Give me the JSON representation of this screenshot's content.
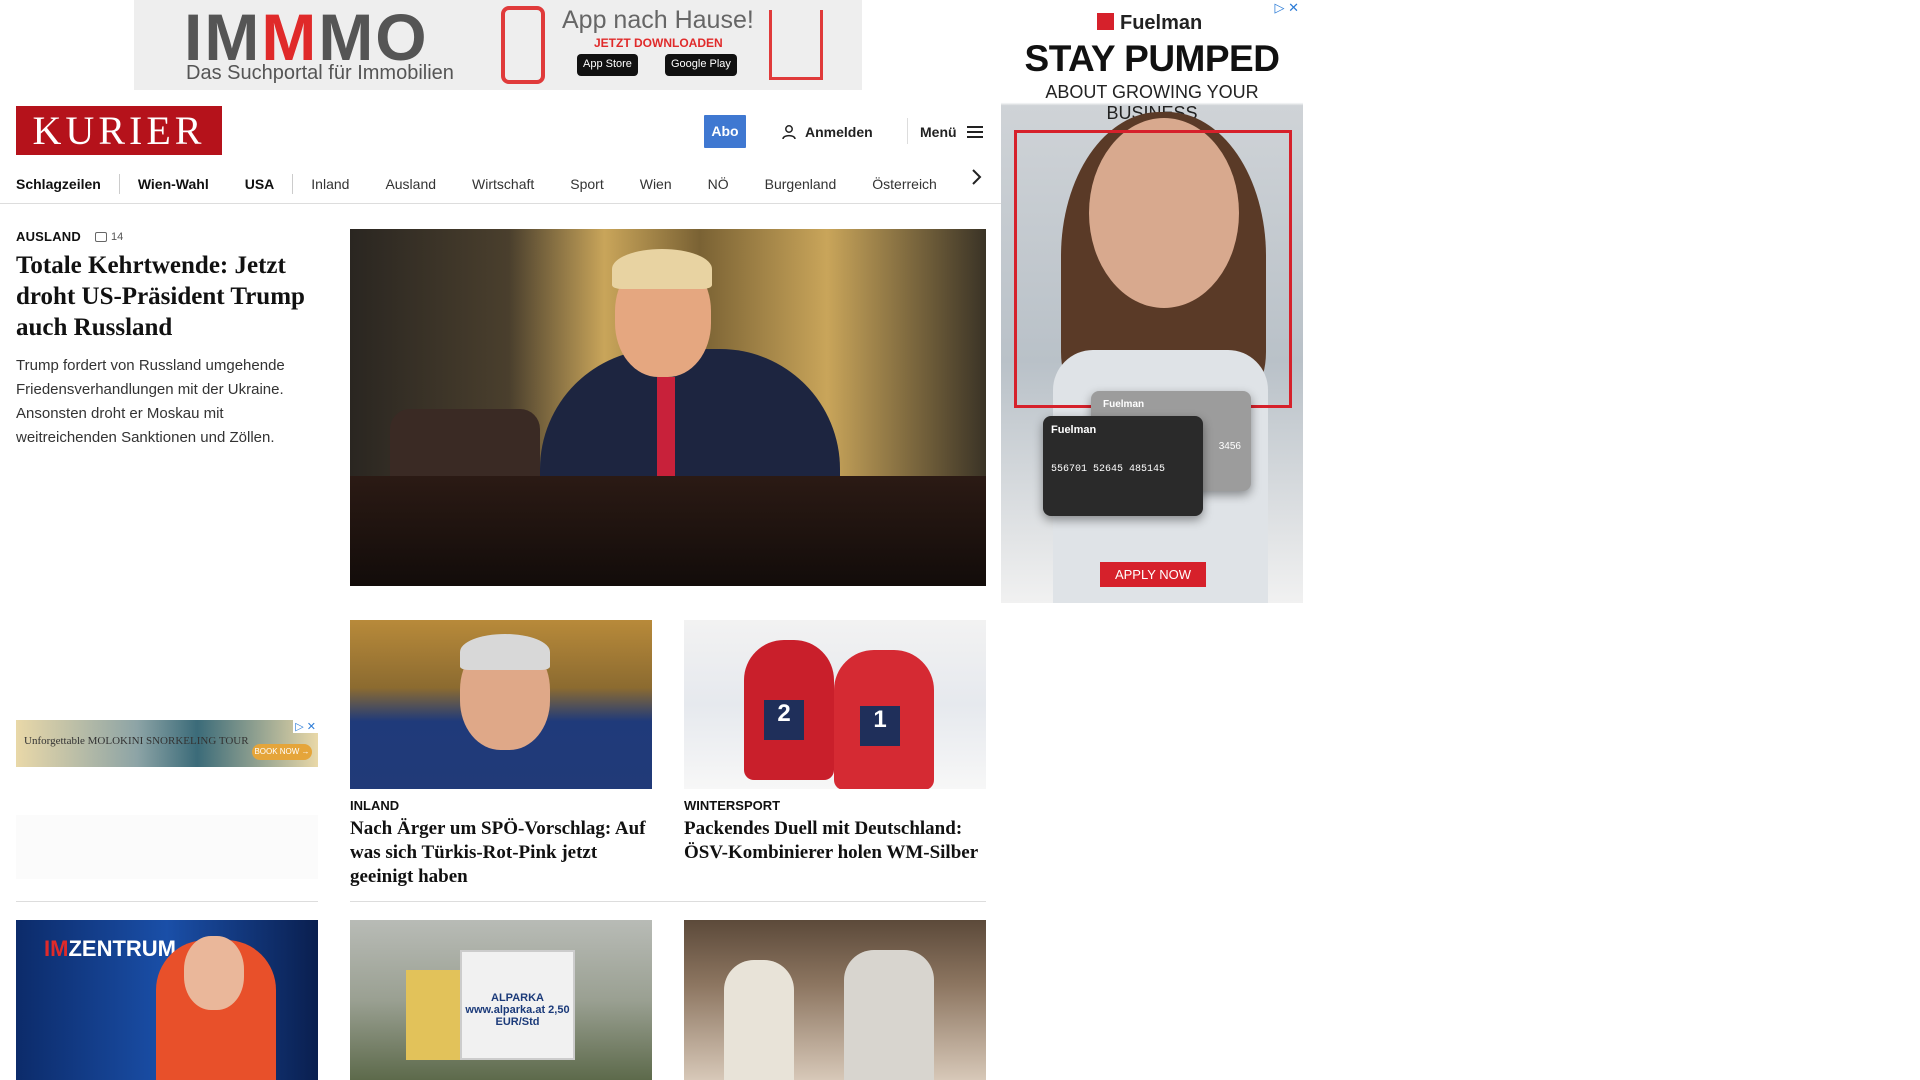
{
  "top_ad": {
    "brand": "IMMMO",
    "tagline": "Das Suchportal für Immobilien",
    "app_title": "App nach Hause!",
    "app_sub": "JETZT DOWNLOADEN",
    "app_store": "App Store",
    "google_play": "Google Play"
  },
  "side_ad": {
    "adchoices": "▷ ✕",
    "brand": "Fuelman",
    "headline": "STAY PUMPED",
    "subline": "ABOUT GROWING YOUR BUSINESS",
    "card_brand": "Fuelman",
    "card_number": "556701 52645 485145",
    "card_last": "3456",
    "cta": "APPLY NOW",
    "colors": {
      "accent": "#d6212b"
    }
  },
  "header": {
    "logo": "KURIER",
    "abo_label": "Abo",
    "login_label": "Anmelden",
    "menu_label": "Menü",
    "colors": {
      "logo_bg": "#b5121b",
      "abo_bg": "#3f78d1"
    }
  },
  "nav": {
    "items": [
      {
        "label": "Schlagzeilen",
        "bold": true
      },
      {
        "label": "Wien-Wahl",
        "bold": true
      },
      {
        "label": "USA",
        "bold": true
      },
      {
        "label": "Inland",
        "bold": false
      },
      {
        "label": "Ausland",
        "bold": false
      },
      {
        "label": "Wirtschaft",
        "bold": false
      },
      {
        "label": "Sport",
        "bold": false
      },
      {
        "label": "Wien",
        "bold": false
      },
      {
        "label": "NÖ",
        "bold": false
      },
      {
        "label": "Burgenland",
        "bold": false
      },
      {
        "label": "Österreich",
        "bold": false
      }
    ],
    "next_icon": "chevron-right-icon"
  },
  "lead": {
    "kicker": "AUSLAND",
    "comments": "14",
    "title": "Totale Kehrtwende: Jetzt droht US-Präsident Trump auch Russland",
    "teaser": "Trump fordert von Russland umgehende Friedensverhandlungen mit der Ukraine. Ansonsten droht er Moskau mit weitreichenden Sanktionen und Zöllen."
  },
  "left_ad": {
    "text": "Unforgettable MOLOKINI SNORKELING TOUR",
    "cta": "BOOK NOW →"
  },
  "cards": [
    {
      "kicker": "INLAND",
      "title": "Nach Ärger um SPÖ-Vorschlag: Auf was sich Türkis-Rot-Pink jetzt geeinigt haben"
    },
    {
      "kicker": "WINTERSPORT",
      "title": "Packendes Duell mit Deutschland: ÖSV-Kombinierer holen WM-Silber"
    }
  ],
  "bottom_row": {
    "show_logo_prefix": "IM",
    "show_logo_rest": "ZENTRUM",
    "sign_text": "ALPARKA www.alparka.at 2,50 EUR/Std"
  },
  "skier_bibs": [
    "2",
    "1"
  ]
}
